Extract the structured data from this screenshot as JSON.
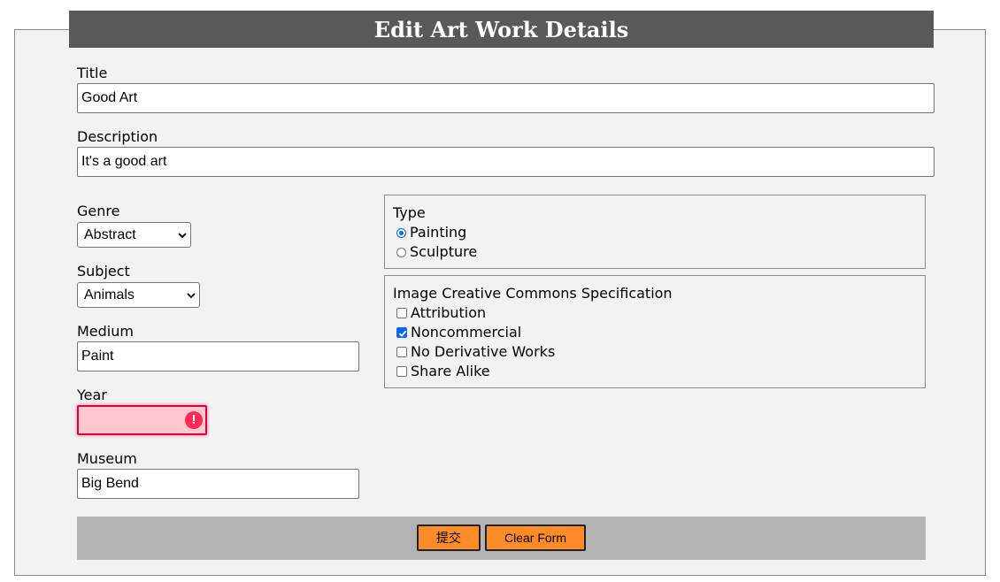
{
  "header": {
    "title": "Edit Art Work Details"
  },
  "form": {
    "title": {
      "label": "Title",
      "value": "Good Art"
    },
    "description": {
      "label": "Description",
      "value": "It's a good art"
    },
    "genre": {
      "label": "Genre",
      "selected": "Abstract"
    },
    "subject": {
      "label": "Subject",
      "selected": "Animals"
    },
    "medium": {
      "label": "Medium",
      "value": "Paint"
    },
    "year": {
      "label": "Year",
      "value": "",
      "invalid": true,
      "warning_icon": "!"
    },
    "museum": {
      "label": "Museum",
      "value": "Big Bend"
    }
  },
  "type_group": {
    "legend": "Type",
    "options": [
      {
        "label": "Painting",
        "checked": true
      },
      {
        "label": "Sculpture",
        "checked": false
      }
    ]
  },
  "cc_group": {
    "legend": "Image Creative Commons Specification",
    "options": [
      {
        "label": "Attribution",
        "checked": false
      },
      {
        "label": "Noncommercial",
        "checked": true
      },
      {
        "label": "No Derivative Works",
        "checked": false
      },
      {
        "label": "Share Alike",
        "checked": false
      }
    ]
  },
  "buttons": {
    "submit": "提交",
    "clear": "Clear Form"
  },
  "colors": {
    "header_bg": "#595959",
    "button_bg": "#ff8c28",
    "invalid_bg": "#ffc8d0",
    "accent": "#0a69e8"
  }
}
